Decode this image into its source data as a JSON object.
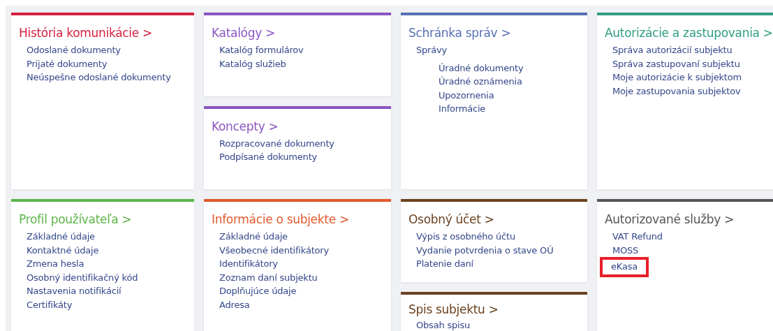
{
  "rows": [
    {
      "columns": [
        [
          {
            "title": "História komunikácie >",
            "color": "#d6213f",
            "links": [
              {
                "label": "Odoslané dokumenty"
              },
              {
                "label": "Prijaté dokumenty"
              },
              {
                "label": "Neúspešne odoslané dokumenty"
              }
            ]
          }
        ],
        [
          {
            "title": "Katalógy >",
            "color": "#8b55c1",
            "links": [
              {
                "label": "Katalóg formulárov"
              },
              {
                "label": "Katalóg služieb"
              }
            ]
          },
          {
            "title": "Koncepty >",
            "color": "#8b55c1",
            "links": [
              {
                "label": "Rozpracované dokumenty"
              },
              {
                "label": "Podpísané dokumenty"
              }
            ]
          }
        ],
        [
          {
            "title": "Schránka správ >",
            "color": "#5670b2",
            "links": [
              {
                "label": "Správy",
                "children": [
                  {
                    "label": "Úradné dokumenty"
                  },
                  {
                    "label": "Úradné oznámenia"
                  },
                  {
                    "label": "Upozornenia"
                  },
                  {
                    "label": "Informácie"
                  }
                ]
              }
            ]
          }
        ],
        [
          {
            "title": "Autorizácie a zastupovania >",
            "color": "#2f9e82",
            "links": [
              {
                "label": "Správa autorizácií subjektu"
              },
              {
                "label": "Správa zastupovaní subjektu"
              },
              {
                "label": "Moje autorizácie k subjektom"
              },
              {
                "label": "Moje zastupovania subjektov"
              }
            ]
          }
        ]
      ]
    },
    {
      "columns": [
        [
          {
            "title": "Profil používateľa >",
            "color": "#5db54a",
            "links": [
              {
                "label": "Základné údaje"
              },
              {
                "label": "Kontaktné údaje"
              },
              {
                "label": "Zmena hesla"
              },
              {
                "label": "Osobný identifikačný kód"
              },
              {
                "label": "Nastavenia notifikácií"
              },
              {
                "label": "Certifikáty"
              }
            ]
          }
        ],
        [
          {
            "title": "Informácie o subjekte >",
            "color": "#e05a2c",
            "links": [
              {
                "label": "Základné údaje"
              },
              {
                "label": "Všeobecné identifikátory"
              },
              {
                "label": "Identifikátory"
              },
              {
                "label": "Zoznam daní subjektu"
              },
              {
                "label": "Doplňujúce údaje"
              },
              {
                "label": "Adresa"
              }
            ]
          }
        ],
        [
          {
            "title": "Osobný účet >",
            "color": "#6b4220",
            "links": [
              {
                "label": "Výpis z osobného účtu"
              },
              {
                "label": "Vydanie potvrdenia o stave OÚ"
              },
              {
                "label": "Platenie daní"
              }
            ]
          },
          {
            "title": "Spis subjektu >",
            "color": "#6b4220",
            "links": [
              {
                "label": "Obsah spisu"
              }
            ]
          }
        ],
        [
          {
            "title": "Autorizované služby >",
            "color": "#555555",
            "links": [
              {
                "label": "VAT Refund",
                "highlighted": false
              },
              {
                "label": "MOSS",
                "highlighted": false
              },
              {
                "label": "eKasa",
                "highlighted": true
              }
            ]
          }
        ]
      ]
    }
  ]
}
